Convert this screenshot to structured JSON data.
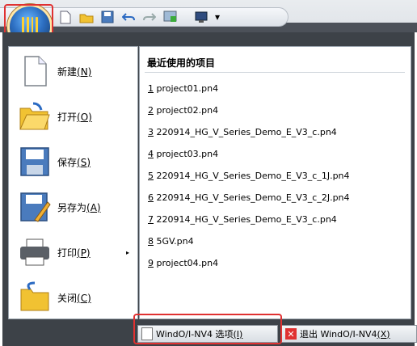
{
  "qat": {
    "icons": [
      "new-doc-icon",
      "open-folder-icon",
      "save-icon",
      "undo-icon",
      "redo-icon",
      "monitor-icon",
      "device-icon"
    ],
    "more": "▾"
  },
  "menu_commands": [
    {
      "label": "新建",
      "key": "(N)",
      "icon": "new-document-icon"
    },
    {
      "label": "打开",
      "key": "(O)",
      "icon": "open-folder-icon"
    },
    {
      "label": "保存",
      "key": "(S)",
      "icon": "save-disk-icon"
    },
    {
      "label": "另存为",
      "key": "(A)",
      "icon": "save-as-icon"
    },
    {
      "label": "打印",
      "key": "(P)",
      "icon": "printer-icon",
      "submenu": "▸"
    },
    {
      "label": "关闭",
      "key": "(C)",
      "icon": "close-folder-icon"
    }
  ],
  "recent": {
    "title": "最近使用的项目",
    "items": [
      {
        "num": "1",
        "name": " project01.pn4"
      },
      {
        "num": "2",
        "name": " project02.pn4"
      },
      {
        "num": "3",
        "name": " 220914_HG_V_Series_Demo_E_V3_c.pn4"
      },
      {
        "num": "4",
        "name": " project03.pn4"
      },
      {
        "num": "5",
        "name": " 220914_HG_V_Series_Demo_E_V3_c_1J.pn4"
      },
      {
        "num": "6",
        "name": " 220914_HG_V_Series_Demo_E_V3_c_2J.pn4"
      },
      {
        "num": "7",
        "name": " 220914_HG_V_Series_Demo_E_V3_c.pn4"
      },
      {
        "num": "8",
        "name": " 5GV.pn4"
      },
      {
        "num": "9",
        "name": " project04.pn4"
      }
    ]
  },
  "bottom": {
    "options_label": "WindO/I-NV4 选项",
    "options_key": "(I)",
    "exit_label": "退出 WindO/I-NV4",
    "exit_key": "(X)"
  },
  "colors": {
    "highlight": "#e03131",
    "menu_bg": "#3d4248"
  }
}
